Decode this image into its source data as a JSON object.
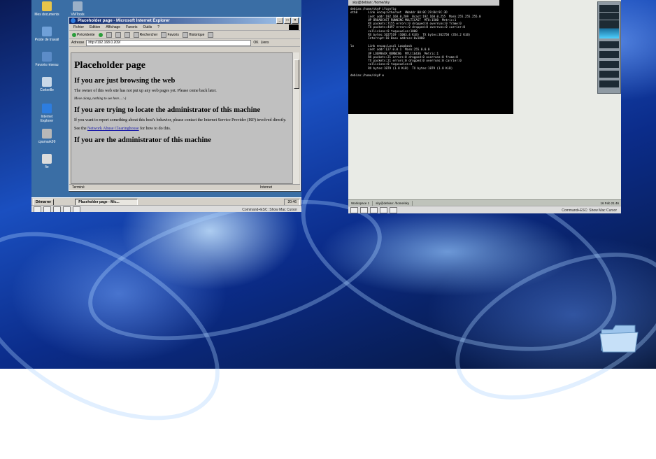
{
  "desktop": {
    "folder_icon": "folder-icon"
  },
  "vm_left": {
    "desktop_icons": [
      {
        "label": "Mes documents",
        "icon": "documents-icon",
        "color": "#e8c54a"
      },
      {
        "label": "VMTools",
        "icon": "tools-icon",
        "color": "#9ab0c8"
      },
      {
        "label": "Poste de travail",
        "icon": "computer-icon",
        "color": "#6fa0d8"
      },
      {
        "label": "Favoris réseau",
        "icon": "network-icon",
        "color": "#5c8cc8"
      },
      {
        "label": "Corbeille",
        "icon": "recycle-bin-icon",
        "color": "#c8d8e8"
      },
      {
        "label": "Internet Explorer",
        "icon": "ie-icon",
        "color": "#2d7de0"
      },
      {
        "label": "cpumark99",
        "icon": "app-icon",
        "color": "#b8b8b8"
      },
      {
        "label": "fie",
        "icon": "file-icon",
        "color": "#dcdcdc"
      }
    ],
    "ie": {
      "title": "Placeholder page - Microsoft Internet Explorer",
      "menu": [
        "Fichier",
        "Edition",
        "Affichage",
        "Favoris",
        "Outils",
        "?"
      ],
      "toolbar": {
        "back": "Précédente",
        "search": "Rechercher",
        "favorites": "Favoris",
        "history": "Historique"
      },
      "address_label": "Adresse",
      "url": "http://192.168.0.209/",
      "go": "OK",
      "links": "Liens",
      "page": {
        "h1": "Placeholder page",
        "h2a": "If you are just browsing the web",
        "p1": "The owner of this web site has not put up any web pages yet. Please come back later.",
        "p2": "Move along, nothing to see here... :-)",
        "h2b": "If you are trying to locate the administrator of this machine",
        "p3": "If you want to report something about this host's behavior, please contact the Internet Service Provider (ISP) involved directly.",
        "p4_pre": "See the",
        "p4_link": "Network Abuse Clearinghouse",
        "p4_post": "for how to do this.",
        "h2c": "If you are the administrator of this machine"
      },
      "status_left": "Terminé",
      "status_zone": "Internet"
    },
    "taskbar": {
      "start": "Démarrer",
      "task": "Placeholder page - Mic...",
      "clock": "20:46"
    },
    "status_hint": "Command+ESC: Show Mac Cursor"
  },
  "vm_right": {
    "terminal": {
      "title": "sky@debian: /home/sky",
      "lines": [
        "debian:/home/sky# ifconfig",
        "eth0      Link encap:Ethernet  HWaddr 00:0C:29:B4:9C:3D",
        "          inet addr:192.168.0.209  Bcast:192.168.0.255  Mask:255.255.255.0",
        "          UP BROADCAST RUNNING MULTICAST  MTU:1500  Metric:1",
        "          RX packets:7155 errors:0 dropped:0 overruns:0 frame:0",
        "          TX packets:4497 errors:0 dropped:0 overruns:0 carrier:0",
        "          collisions:0 txqueuelen:1000",
        "          RX bytes:1027519 (1003.4 KiB)  TX bytes:362750 (354.2 KiB)",
        "          Interrupt:18 Base address:0x1080",
        "",
        "lo        Link encap:Local Loopback",
        "          inet addr:127.0.0.1  Mask:255.0.0.0",
        "          UP LOOPBACK RUNNING  MTU:16436  Metric:1",
        "          RX packets:21 errors:0 dropped:0 overruns:0 frame:0",
        "          TX packets:21 errors:0 dropped:0 overruns:0 carrier:0",
        "          collisions:0 txqueuelen:0",
        "          RX bytes:1879 (1.8 KiB)  TX bytes:1879 (1.8 KiB)",
        "",
        "debian:/home/sky# ▮"
      ]
    },
    "panel": {
      "item1": "Workspace 1",
      "item2": "sky@debian: /home/sky",
      "clock": "16 Feb 21:46"
    },
    "status_hint": "Command+ESC: Show Mac Cursor"
  }
}
